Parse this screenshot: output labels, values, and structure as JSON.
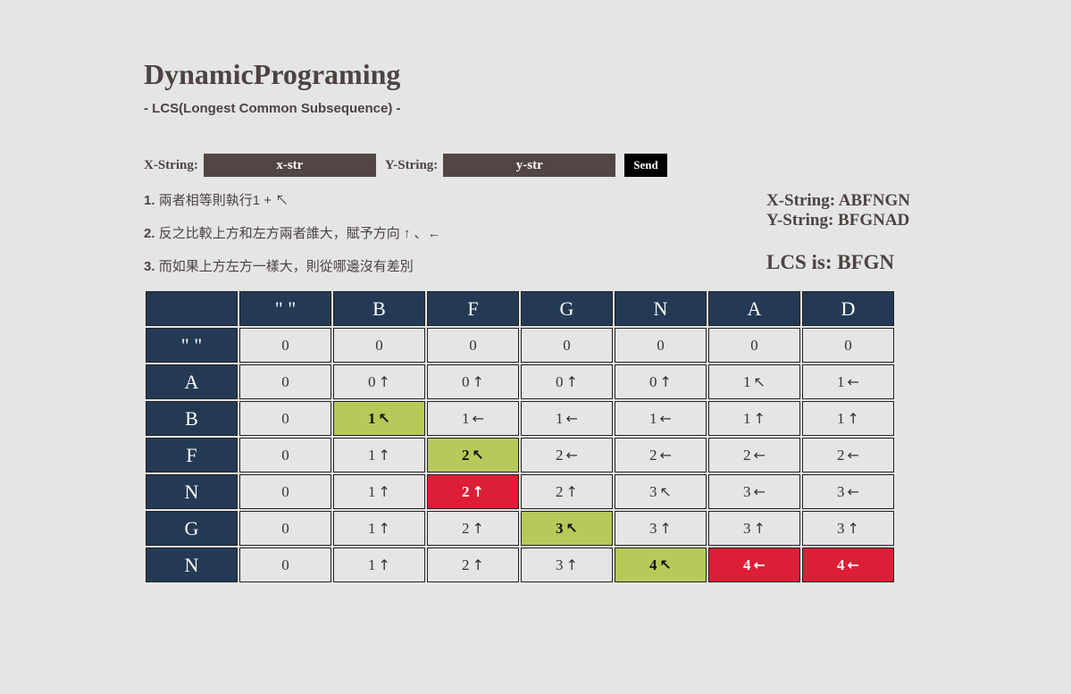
{
  "header": {
    "title": "DynamicPrograming",
    "subtitle": "- LCS(Longest Common Subsequence) -"
  },
  "form": {
    "x_label": "X-String:",
    "x_placeholder": "x-str",
    "y_label": "Y-String:",
    "y_placeholder": "y-str",
    "send_label": "Send"
  },
  "rules": [
    {
      "num": "1.",
      "text": "兩者相等則執行1 + ↖"
    },
    {
      "num": "2.",
      "text": "反之比較上方和左方兩者誰大，賦予方向 ↑ 、←"
    },
    {
      "num": "3.",
      "text": "而如果上方左方一樣大，則從哪邊沒有差別"
    }
  ],
  "result": {
    "x_string": "X-String: ABFNGN",
    "y_string": "Y-String: BFGNAD",
    "lcs": "LCS is: BFGN"
  },
  "table": {
    "col_headers": [
      "",
      "\" \"",
      "B",
      "F",
      "G",
      "N",
      "A",
      "D"
    ],
    "rows": [
      {
        "label": "\" \"",
        "cells": [
          {
            "v": "0",
            "a": "",
            "s": ""
          },
          {
            "v": "0",
            "a": "",
            "s": ""
          },
          {
            "v": "0",
            "a": "",
            "s": ""
          },
          {
            "v": "0",
            "a": "",
            "s": ""
          },
          {
            "v": "0",
            "a": "",
            "s": ""
          },
          {
            "v": "0",
            "a": "",
            "s": ""
          },
          {
            "v": "0",
            "a": "",
            "s": ""
          }
        ]
      },
      {
        "label": "A",
        "cells": [
          {
            "v": "0",
            "a": "",
            "s": ""
          },
          {
            "v": "0",
            "a": "↑",
            "s": ""
          },
          {
            "v": "0",
            "a": "↑",
            "s": ""
          },
          {
            "v": "0",
            "a": "↑",
            "s": ""
          },
          {
            "v": "0",
            "a": "↑",
            "s": ""
          },
          {
            "v": "1",
            "a": "↖",
            "s": ""
          },
          {
            "v": "1",
            "a": "←",
            "s": ""
          }
        ]
      },
      {
        "label": "B",
        "cells": [
          {
            "v": "0",
            "a": "",
            "s": ""
          },
          {
            "v": "1",
            "a": "↖",
            "s": "match"
          },
          {
            "v": "1",
            "a": "←",
            "s": ""
          },
          {
            "v": "1",
            "a": "←",
            "s": ""
          },
          {
            "v": "1",
            "a": "←",
            "s": ""
          },
          {
            "v": "1",
            "a": "↑",
            "s": ""
          },
          {
            "v": "1",
            "a": "↑",
            "s": ""
          }
        ]
      },
      {
        "label": "F",
        "cells": [
          {
            "v": "0",
            "a": "",
            "s": ""
          },
          {
            "v": "1",
            "a": "↑",
            "s": ""
          },
          {
            "v": "2",
            "a": "↖",
            "s": "match"
          },
          {
            "v": "2",
            "a": "←",
            "s": ""
          },
          {
            "v": "2",
            "a": "←",
            "s": ""
          },
          {
            "v": "2",
            "a": "←",
            "s": ""
          },
          {
            "v": "2",
            "a": "←",
            "s": ""
          }
        ]
      },
      {
        "label": "N",
        "cells": [
          {
            "v": "0",
            "a": "",
            "s": ""
          },
          {
            "v": "1",
            "a": "↑",
            "s": ""
          },
          {
            "v": "2",
            "a": "↑",
            "s": "path"
          },
          {
            "v": "2",
            "a": "↑",
            "s": ""
          },
          {
            "v": "3",
            "a": "↖",
            "s": ""
          },
          {
            "v": "3",
            "a": "←",
            "s": ""
          },
          {
            "v": "3",
            "a": "←",
            "s": ""
          }
        ]
      },
      {
        "label": "G",
        "cells": [
          {
            "v": "0",
            "a": "",
            "s": ""
          },
          {
            "v": "1",
            "a": "↑",
            "s": ""
          },
          {
            "v": "2",
            "a": "↑",
            "s": ""
          },
          {
            "v": "3",
            "a": "↖",
            "s": "match"
          },
          {
            "v": "3",
            "a": "↑",
            "s": ""
          },
          {
            "v": "3",
            "a": "↑",
            "s": ""
          },
          {
            "v": "3",
            "a": "↑",
            "s": ""
          }
        ]
      },
      {
        "label": "N",
        "cells": [
          {
            "v": "0",
            "a": "",
            "s": ""
          },
          {
            "v": "1",
            "a": "↑",
            "s": ""
          },
          {
            "v": "2",
            "a": "↑",
            "s": ""
          },
          {
            "v": "3",
            "a": "↑",
            "s": ""
          },
          {
            "v": "4",
            "a": "↖",
            "s": "match"
          },
          {
            "v": "4",
            "a": "←",
            "s": "path"
          },
          {
            "v": "4",
            "a": "←",
            "s": "path"
          }
        ]
      }
    ]
  },
  "colors": {
    "background": "#e5e5e5",
    "header_bg": "#243a54",
    "match_bg": "#b8c95a",
    "path_bg": "#dc1f36",
    "input_bg": "#524645"
  }
}
